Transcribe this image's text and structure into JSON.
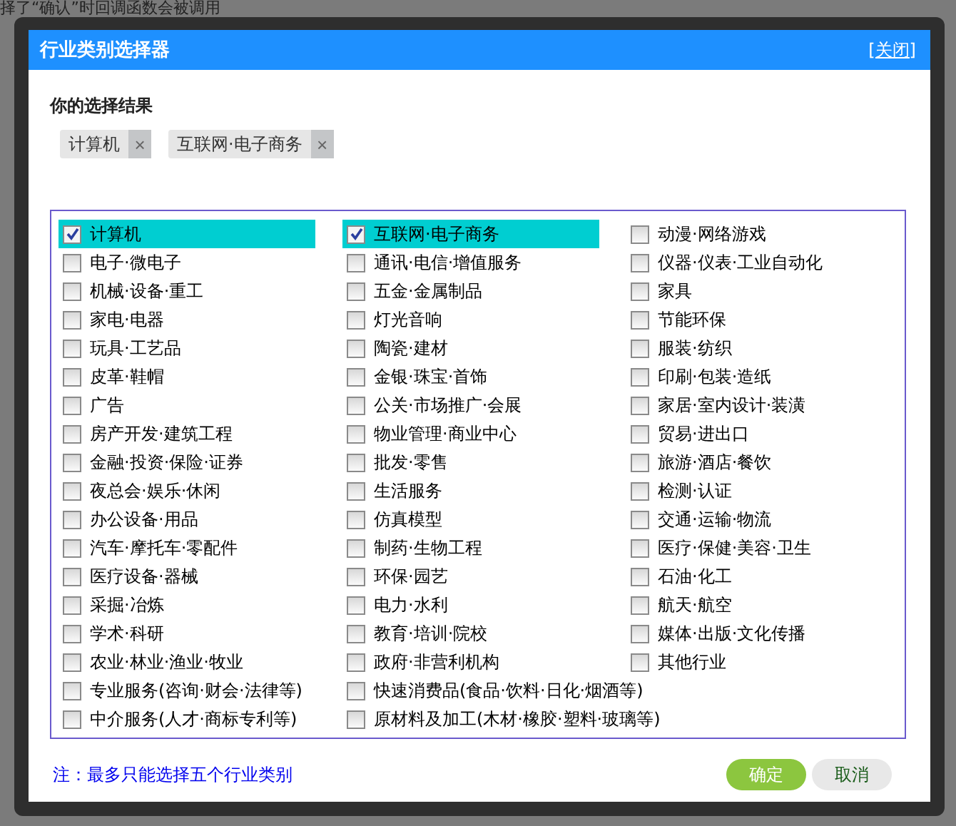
{
  "background_text": [
    "择了“确认”时回调函数会被调用"
  ],
  "dialog": {
    "title": "行业类别选择器",
    "close_link": "[关闭]"
  },
  "selection": {
    "heading": "你的选择结果",
    "tags": [
      {
        "label": "计算机",
        "remove": "×"
      },
      {
        "label": "互联网·电子商务",
        "remove": "×"
      }
    ]
  },
  "columns": [
    [
      {
        "label": "计算机",
        "checked": true
      },
      {
        "label": "电子·微电子",
        "checked": false
      },
      {
        "label": "机械·设备·重工",
        "checked": false
      },
      {
        "label": "家电·电器",
        "checked": false
      },
      {
        "label": "玩具·工艺品",
        "checked": false
      },
      {
        "label": "皮革·鞋帽",
        "checked": false
      },
      {
        "label": "广告",
        "checked": false
      },
      {
        "label": "房产开发·建筑工程",
        "checked": false
      },
      {
        "label": "金融·投资·保险·证券",
        "checked": false
      },
      {
        "label": "夜总会·娱乐·休闲",
        "checked": false
      },
      {
        "label": "办公设备·用品",
        "checked": false
      },
      {
        "label": "汽车·摩托车·零配件",
        "checked": false
      },
      {
        "label": "医疗设备·器械",
        "checked": false
      },
      {
        "label": "采掘·冶炼",
        "checked": false
      },
      {
        "label": "学术·科研",
        "checked": false
      },
      {
        "label": "农业·林业·渔业·牧业",
        "checked": false
      },
      {
        "label": "专业服务(咨询·财会·法律等)",
        "checked": false
      },
      {
        "label": "中介服务(人才·商标专利等)",
        "checked": false
      }
    ],
    [
      {
        "label": "互联网·电子商务",
        "checked": true
      },
      {
        "label": "通讯·电信·增值服务",
        "checked": false
      },
      {
        "label": "五金·金属制品",
        "checked": false
      },
      {
        "label": "灯光音响",
        "checked": false
      },
      {
        "label": "陶瓷·建材",
        "checked": false
      },
      {
        "label": "金银·珠宝·首饰",
        "checked": false
      },
      {
        "label": "公关·市场推广·会展",
        "checked": false
      },
      {
        "label": "物业管理·商业中心",
        "checked": false
      },
      {
        "label": "批发·零售",
        "checked": false
      },
      {
        "label": "生活服务",
        "checked": false
      },
      {
        "label": "仿真模型",
        "checked": false
      },
      {
        "label": "制药·生物工程",
        "checked": false
      },
      {
        "label": "环保·园艺",
        "checked": false
      },
      {
        "label": "电力·水利",
        "checked": false
      },
      {
        "label": "教育·培训·院校",
        "checked": false
      },
      {
        "label": "政府·非营利机构",
        "checked": false
      },
      {
        "label": "快速消费品(食品·饮料·日化·烟酒等)",
        "checked": false
      },
      {
        "label": "原材料及加工(木材·橡胶·塑料·玻璃等)",
        "checked": false
      }
    ],
    [
      {
        "label": "动漫·网络游戏",
        "checked": false
      },
      {
        "label": "仪器·仪表·工业自动化",
        "checked": false
      },
      {
        "label": "家具",
        "checked": false
      },
      {
        "label": "节能环保",
        "checked": false
      },
      {
        "label": "服装·纺织",
        "checked": false
      },
      {
        "label": "印刷·包装·造纸",
        "checked": false
      },
      {
        "label": "家居·室内设计·装潢",
        "checked": false
      },
      {
        "label": "贸易·进出口",
        "checked": false
      },
      {
        "label": "旅游·酒店·餐饮",
        "checked": false
      },
      {
        "label": "检测·认证",
        "checked": false
      },
      {
        "label": "交通·运输·物流",
        "checked": false
      },
      {
        "label": "医疗·保健·美容·卫生",
        "checked": false
      },
      {
        "label": "石油·化工",
        "checked": false
      },
      {
        "label": "航天·航空",
        "checked": false
      },
      {
        "label": "媒体·出版·文化传播",
        "checked": false
      },
      {
        "label": "其他行业",
        "checked": false
      }
    ]
  ],
  "note": "注：最多只能选择五个行业类别",
  "buttons": [
    {
      "label": "确定",
      "kind": "primary"
    },
    {
      "label": "取消",
      "kind": "secondary"
    }
  ]
}
